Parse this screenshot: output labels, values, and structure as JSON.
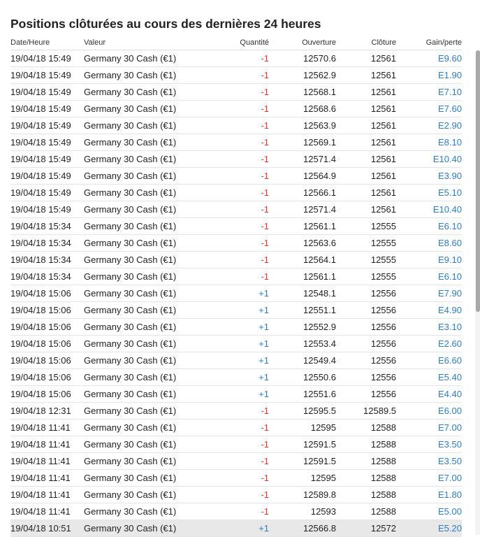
{
  "title": "Positions clôturées au cours des dernières 24 heures",
  "columns": {
    "date": "Date/Heure",
    "value": "Valeur",
    "quantity": "Quantité",
    "open": "Ouverture",
    "close": "Clôture",
    "gain": "Gain/perte"
  },
  "colors": {
    "negative_quantity": "#e53935",
    "positive_quantity": "#2f7cc1",
    "gain": "#2f7cc1"
  },
  "rows": [
    {
      "date": "19/04/18 15:49",
      "value": "Germany 30 Cash (€1)",
      "qty": "-1",
      "open": "12570.6",
      "close": "12561",
      "gain": "E9.60"
    },
    {
      "date": "19/04/18 15:49",
      "value": "Germany 30 Cash (€1)",
      "qty": "-1",
      "open": "12562.9",
      "close": "12561",
      "gain": "E1.90"
    },
    {
      "date": "19/04/18 15:49",
      "value": "Germany 30 Cash (€1)",
      "qty": "-1",
      "open": "12568.1",
      "close": "12561",
      "gain": "E7.10"
    },
    {
      "date": "19/04/18 15:49",
      "value": "Germany 30 Cash (€1)",
      "qty": "-1",
      "open": "12568.6",
      "close": "12561",
      "gain": "E7.60"
    },
    {
      "date": "19/04/18 15:49",
      "value": "Germany 30 Cash (€1)",
      "qty": "-1",
      "open": "12563.9",
      "close": "12561",
      "gain": "E2.90"
    },
    {
      "date": "19/04/18 15:49",
      "value": "Germany 30 Cash (€1)",
      "qty": "-1",
      "open": "12569.1",
      "close": "12561",
      "gain": "E8.10"
    },
    {
      "date": "19/04/18 15:49",
      "value": "Germany 30 Cash (€1)",
      "qty": "-1",
      "open": "12571.4",
      "close": "12561",
      "gain": "E10.40"
    },
    {
      "date": "19/04/18 15:49",
      "value": "Germany 30 Cash (€1)",
      "qty": "-1",
      "open": "12564.9",
      "close": "12561",
      "gain": "E3.90"
    },
    {
      "date": "19/04/18 15:49",
      "value": "Germany 30 Cash (€1)",
      "qty": "-1",
      "open": "12566.1",
      "close": "12561",
      "gain": "E5.10"
    },
    {
      "date": "19/04/18 15:49",
      "value": "Germany 30 Cash (€1)",
      "qty": "-1",
      "open": "12571.4",
      "close": "12561",
      "gain": "E10.40"
    },
    {
      "date": "19/04/18 15:34",
      "value": "Germany 30 Cash (€1)",
      "qty": "-1",
      "open": "12561.1",
      "close": "12555",
      "gain": "E6.10"
    },
    {
      "date": "19/04/18 15:34",
      "value": "Germany 30 Cash (€1)",
      "qty": "-1",
      "open": "12563.6",
      "close": "12555",
      "gain": "E8.60"
    },
    {
      "date": "19/04/18 15:34",
      "value": "Germany 30 Cash (€1)",
      "qty": "-1",
      "open": "12564.1",
      "close": "12555",
      "gain": "E9.10"
    },
    {
      "date": "19/04/18 15:34",
      "value": "Germany 30 Cash (€1)",
      "qty": "-1",
      "open": "12561.1",
      "close": "12555",
      "gain": "E6.10"
    },
    {
      "date": "19/04/18 15:06",
      "value": "Germany 30 Cash (€1)",
      "qty": "+1",
      "open": "12548.1",
      "close": "12556",
      "gain": "E7.90"
    },
    {
      "date": "19/04/18 15:06",
      "value": "Germany 30 Cash (€1)",
      "qty": "+1",
      "open": "12551.1",
      "close": "12556",
      "gain": "E4.90"
    },
    {
      "date": "19/04/18 15:06",
      "value": "Germany 30 Cash (€1)",
      "qty": "+1",
      "open": "12552.9",
      "close": "12556",
      "gain": "E3.10"
    },
    {
      "date": "19/04/18 15:06",
      "value": "Germany 30 Cash (€1)",
      "qty": "+1",
      "open": "12553.4",
      "close": "12556",
      "gain": "E2.60"
    },
    {
      "date": "19/04/18 15:06",
      "value": "Germany 30 Cash (€1)",
      "qty": "+1",
      "open": "12549.4",
      "close": "12556",
      "gain": "E6.60"
    },
    {
      "date": "19/04/18 15:06",
      "value": "Germany 30 Cash (€1)",
      "qty": "+1",
      "open": "12550.6",
      "close": "12556",
      "gain": "E5.40"
    },
    {
      "date": "19/04/18 15:06",
      "value": "Germany 30 Cash (€1)",
      "qty": "+1",
      "open": "12551.6",
      "close": "12556",
      "gain": "E4.40"
    },
    {
      "date": "19/04/18 12:31",
      "value": "Germany 30 Cash (€1)",
      "qty": "-1",
      "open": "12595.5",
      "close": "12589.5",
      "gain": "E6.00"
    },
    {
      "date": "19/04/18 11:41",
      "value": "Germany 30 Cash (€1)",
      "qty": "-1",
      "open": "12595",
      "close": "12588",
      "gain": "E7.00"
    },
    {
      "date": "19/04/18 11:41",
      "value": "Germany 30 Cash (€1)",
      "qty": "-1",
      "open": "12591.5",
      "close": "12588",
      "gain": "E3.50"
    },
    {
      "date": "19/04/18 11:41",
      "value": "Germany 30 Cash (€1)",
      "qty": "-1",
      "open": "12591.5",
      "close": "12588",
      "gain": "E3.50"
    },
    {
      "date": "19/04/18 11:41",
      "value": "Germany 30 Cash (€1)",
      "qty": "-1",
      "open": "12595",
      "close": "12588",
      "gain": "E7.00"
    },
    {
      "date": "19/04/18 11:41",
      "value": "Germany 30 Cash (€1)",
      "qty": "-1",
      "open": "12589.8",
      "close": "12588",
      "gain": "E1.80"
    },
    {
      "date": "19/04/18 11:41",
      "value": "Germany 30 Cash (€1)",
      "qty": "-1",
      "open": "12593",
      "close": "12588",
      "gain": "E5.00"
    },
    {
      "date": "19/04/18 10:51",
      "value": "Germany 30 Cash (€1)",
      "qty": "+1",
      "open": "12566.8",
      "close": "12572",
      "gain": "E5.20"
    }
  ]
}
